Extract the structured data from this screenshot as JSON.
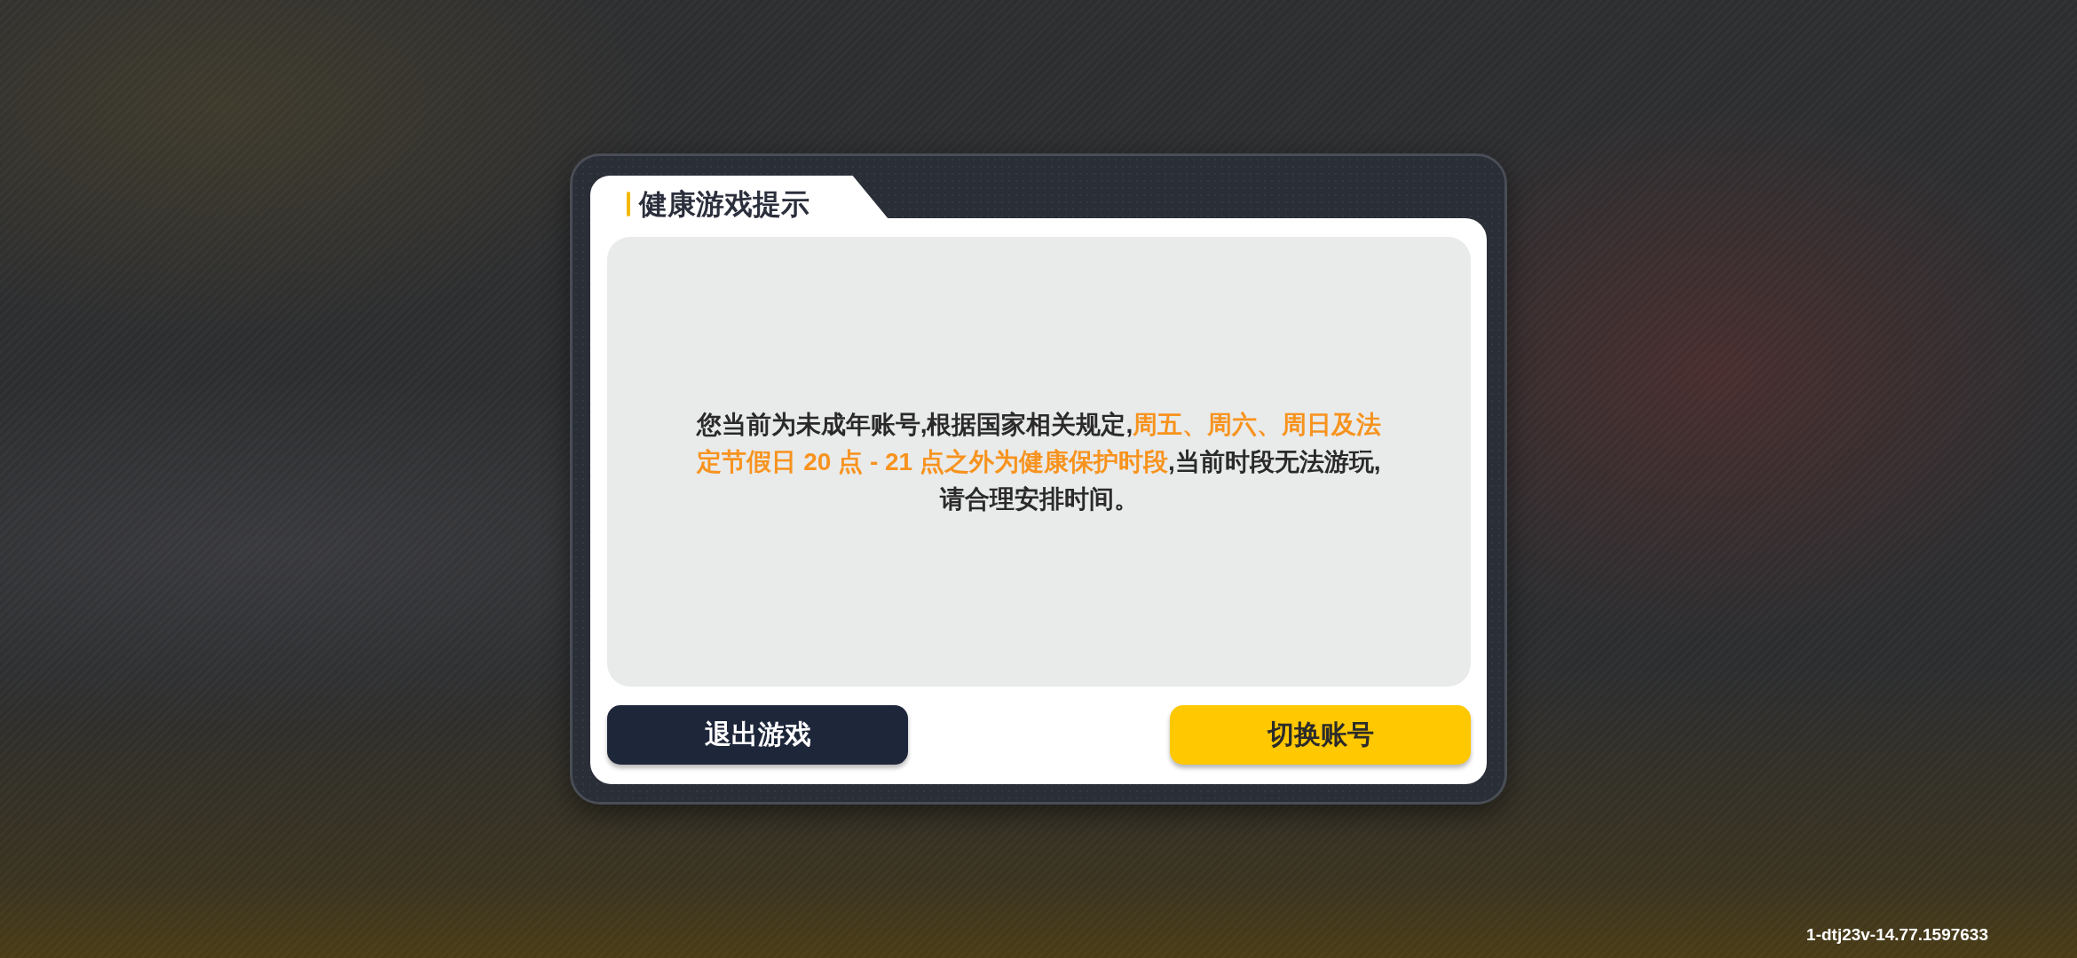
{
  "dialog": {
    "title": "健康游戏提示",
    "message": [
      {
        "text": "您当前为未成年账号,根据国家相关规定,",
        "highlight": false
      },
      {
        "text": "周五、周六、周日及法定节假日 20 点 - 21 点之外为健康保护时段",
        "highlight": true
      },
      {
        "text": ",当前时段无法游玩,请合理安排时间。",
        "highlight": false
      }
    ],
    "buttons": [
      {
        "label": "退出游戏",
        "kind": "secondary"
      },
      {
        "label": "切换账号",
        "kind": "primary"
      }
    ]
  },
  "version": "1-dtj23v-14.77.1597633"
}
